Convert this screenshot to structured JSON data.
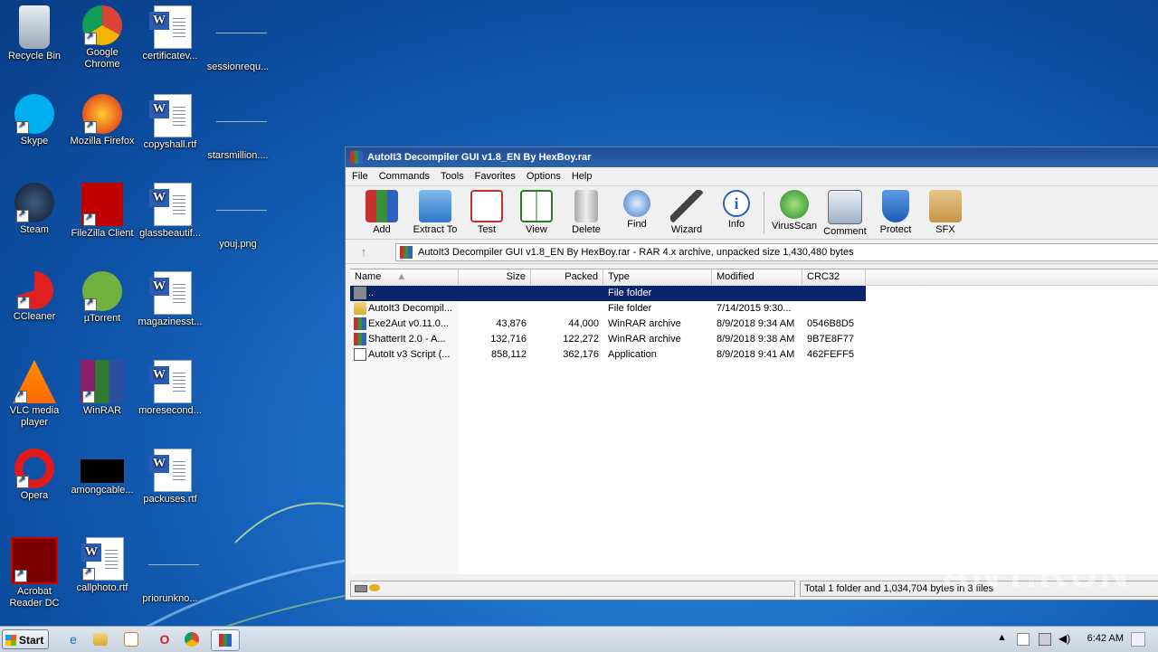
{
  "desktop": {
    "icons": [
      {
        "label": "Recycle Bin",
        "icon": "recycle-bin-icon"
      },
      {
        "label": "Google Chrome",
        "icon": "chrome-icon"
      },
      {
        "label": "certificatev...",
        "icon": "word-doc-icon"
      },
      {
        "label": "sessionrequ...",
        "icon": "blank-file-icon"
      },
      {
        "label": "Skype",
        "icon": "skype-icon"
      },
      {
        "label": "Mozilla Firefox",
        "icon": "firefox-icon"
      },
      {
        "label": "copyshall.rtf",
        "icon": "word-doc-icon"
      },
      {
        "label": "starsmillion....",
        "icon": "blank-file-icon"
      },
      {
        "label": "Steam",
        "icon": "steam-icon"
      },
      {
        "label": "FileZilla Client",
        "icon": "filezilla-icon"
      },
      {
        "label": "glassbeautif...",
        "icon": "word-doc-icon"
      },
      {
        "label": "youj.png",
        "icon": "blank-file-icon"
      },
      {
        "label": "CCleaner",
        "icon": "ccleaner-icon"
      },
      {
        "label": "µTorrent",
        "icon": "utorrent-icon"
      },
      {
        "label": "magazinesst...",
        "icon": "word-doc-icon"
      },
      {
        "label": "VLC media player",
        "icon": "vlc-icon"
      },
      {
        "label": "WinRAR",
        "icon": "winrar-icon"
      },
      {
        "label": "moresecond...",
        "icon": "word-doc-icon"
      },
      {
        "label": "Opera",
        "icon": "opera-icon"
      },
      {
        "label": "amongcable...",
        "icon": "black-image-icon"
      },
      {
        "label": "packuses.rtf",
        "icon": "word-doc-icon"
      },
      {
        "label": "Acrobat Reader DC",
        "icon": "acrobat-icon"
      },
      {
        "label": "callphoto.rtf",
        "icon": "word-doc-icon"
      },
      {
        "label": "priorunkno...",
        "icon": "blank-file-icon"
      }
    ]
  },
  "window": {
    "title": "AutoIt3 Decompiler GUI v1.8_EN By HexBoy.rar",
    "menu": [
      "File",
      "Commands",
      "Tools",
      "Favorites",
      "Options",
      "Help"
    ],
    "toolbar": [
      "Add",
      "Extract To",
      "Test",
      "View",
      "Delete",
      "Find",
      "Wizard",
      "Info",
      "VirusScan",
      "Comment",
      "Protect",
      "SFX"
    ],
    "address": "AutoIt3 Decompiler GUI v1.8_EN By HexBoy.rar - RAR 4.x archive, unpacked size 1,430,480 bytes",
    "columns": [
      "Name",
      "Size",
      "Packed",
      "Type",
      "Modified",
      "CRC32"
    ],
    "rows": [
      {
        "name": "..",
        "size": "",
        "packed": "",
        "type": "File folder",
        "modified": "",
        "crc": ""
      },
      {
        "name": "AutoIt3 Decompil...",
        "size": "",
        "packed": "",
        "type": "File folder",
        "modified": "7/14/2015 9:30...",
        "crc": ""
      },
      {
        "name": "Exe2Aut v0.11.0...",
        "size": "43,876",
        "packed": "44,000",
        "type": "WinRAR archive",
        "modified": "8/9/2018 9:34 AM",
        "crc": "0546B8D5"
      },
      {
        "name": "ShatterIt 2.0 - A...",
        "size": "132,716",
        "packed": "122,272",
        "type": "WinRAR archive",
        "modified": "8/9/2018 9:38 AM",
        "crc": "9B7E8F77"
      },
      {
        "name": "AutoIt v3 Script (...",
        "size": "858,112",
        "packed": "362,176",
        "type": "Application",
        "modified": "8/9/2018 9:41 AM",
        "crc": "462FEFF5"
      }
    ],
    "status": "Total 1 folder and 1,034,704 bytes in 3 files"
  },
  "taskbar": {
    "start": "Start",
    "clock": "6:42 AM"
  },
  "watermark": "ANY.RUN"
}
